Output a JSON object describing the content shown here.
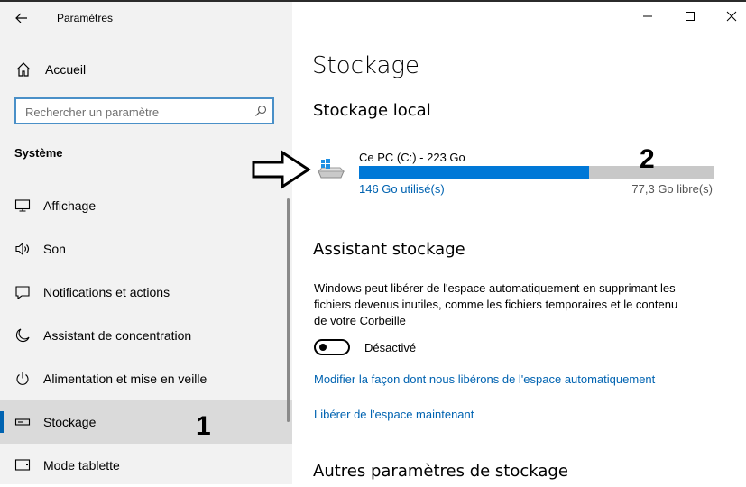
{
  "window": {
    "title": "Paramètres",
    "controls": [
      "minimize-icon",
      "maximize-icon",
      "close-icon"
    ]
  },
  "sidebar": {
    "home_label": "Accueil",
    "search_placeholder": "Rechercher un paramètre",
    "section_title": "Système",
    "items": [
      {
        "label": "Affichage",
        "icon": "display-icon"
      },
      {
        "label": "Son",
        "icon": "speaker-icon"
      },
      {
        "label": "Notifications et actions",
        "icon": "notification-icon"
      },
      {
        "label": "Assistant de concentration",
        "icon": "moon-icon"
      },
      {
        "label": "Alimentation et mise en veille",
        "icon": "power-icon"
      },
      {
        "label": "Stockage",
        "icon": "storage-icon",
        "selected": true
      },
      {
        "label": "Mode tablette",
        "icon": "tablet-icon"
      }
    ],
    "accent_color": "#0063b1"
  },
  "annotations": {
    "one": "1",
    "two": "2"
  },
  "main": {
    "title": "Stockage",
    "local_heading": "Stockage local",
    "drive": {
      "name": "Ce PC (C:) - 223 Go",
      "used_label": "146 Go utilisé(s)",
      "free_label": "77,3 Go libre(s)",
      "used_fraction": 0.65,
      "bar_color": "#0078d7"
    },
    "assistant_heading": "Assistant stockage",
    "assistant_description": "Windows peut libérer de l'espace automatiquement en supprimant les fichiers devenus inutiles, comme les fichiers temporaires et le contenu de votre Corbeille",
    "toggle_label": "Désactivé",
    "toggle_on": false,
    "link_modify": "Modifier la façon dont nous libérons de l'espace automatiquement",
    "link_free_now": "Libérer de l'espace maintenant",
    "other_heading": "Autres paramètres de stockage"
  }
}
